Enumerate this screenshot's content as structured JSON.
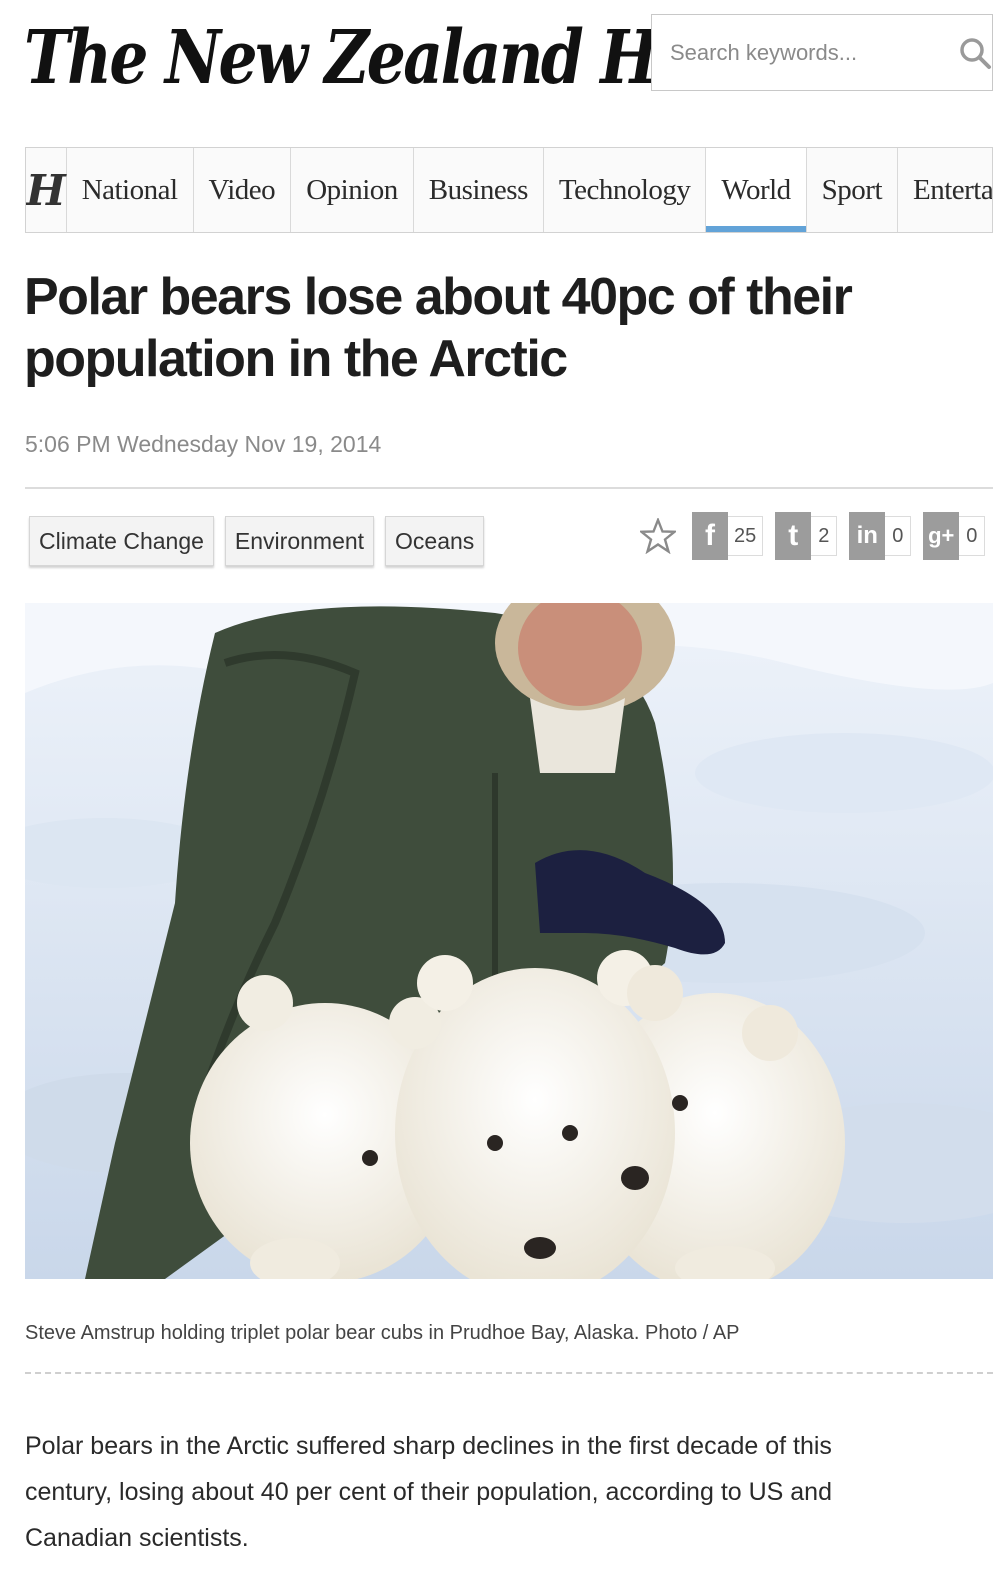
{
  "masthead": {
    "logo_text": "The New Zealand Herald"
  },
  "search": {
    "placeholder": "Search keywords..."
  },
  "nav": {
    "logo_letter": "H",
    "items": [
      {
        "label": "National"
      },
      {
        "label": "Video"
      },
      {
        "label": "Opinion"
      },
      {
        "label": "Business"
      },
      {
        "label": "Technology"
      },
      {
        "label": "World",
        "active": true
      },
      {
        "label": "Sport"
      },
      {
        "label": "Entertainmen"
      }
    ]
  },
  "article": {
    "headline": "Polar bears lose about 40pc of their population in the Arctic",
    "dateline": "5:06 PM Wednesday Nov 19, 2014",
    "tags": [
      "Climate Change",
      "Environment",
      "Oceans"
    ],
    "share": {
      "facebook_icon": "f",
      "facebook_count": "25",
      "twitter_icon": "t",
      "twitter_count": "2",
      "linkedin_icon": "in",
      "linkedin_count": "0",
      "googleplus_icon": "g+",
      "googleplus_count": "0"
    },
    "caption": "Steve Amstrup holding triplet polar bear cubs in Prudhoe Bay, Alaska. Photo / AP",
    "body": "Polar bears in the Arctic suffered sharp declines in the first decade of this century, losing about 40 per cent of their population, according to US and Canadian scientists."
  },
  "colors": {
    "nav_active_underline": "#62a3d8",
    "share_icon_grey": "#9c9c9c"
  }
}
